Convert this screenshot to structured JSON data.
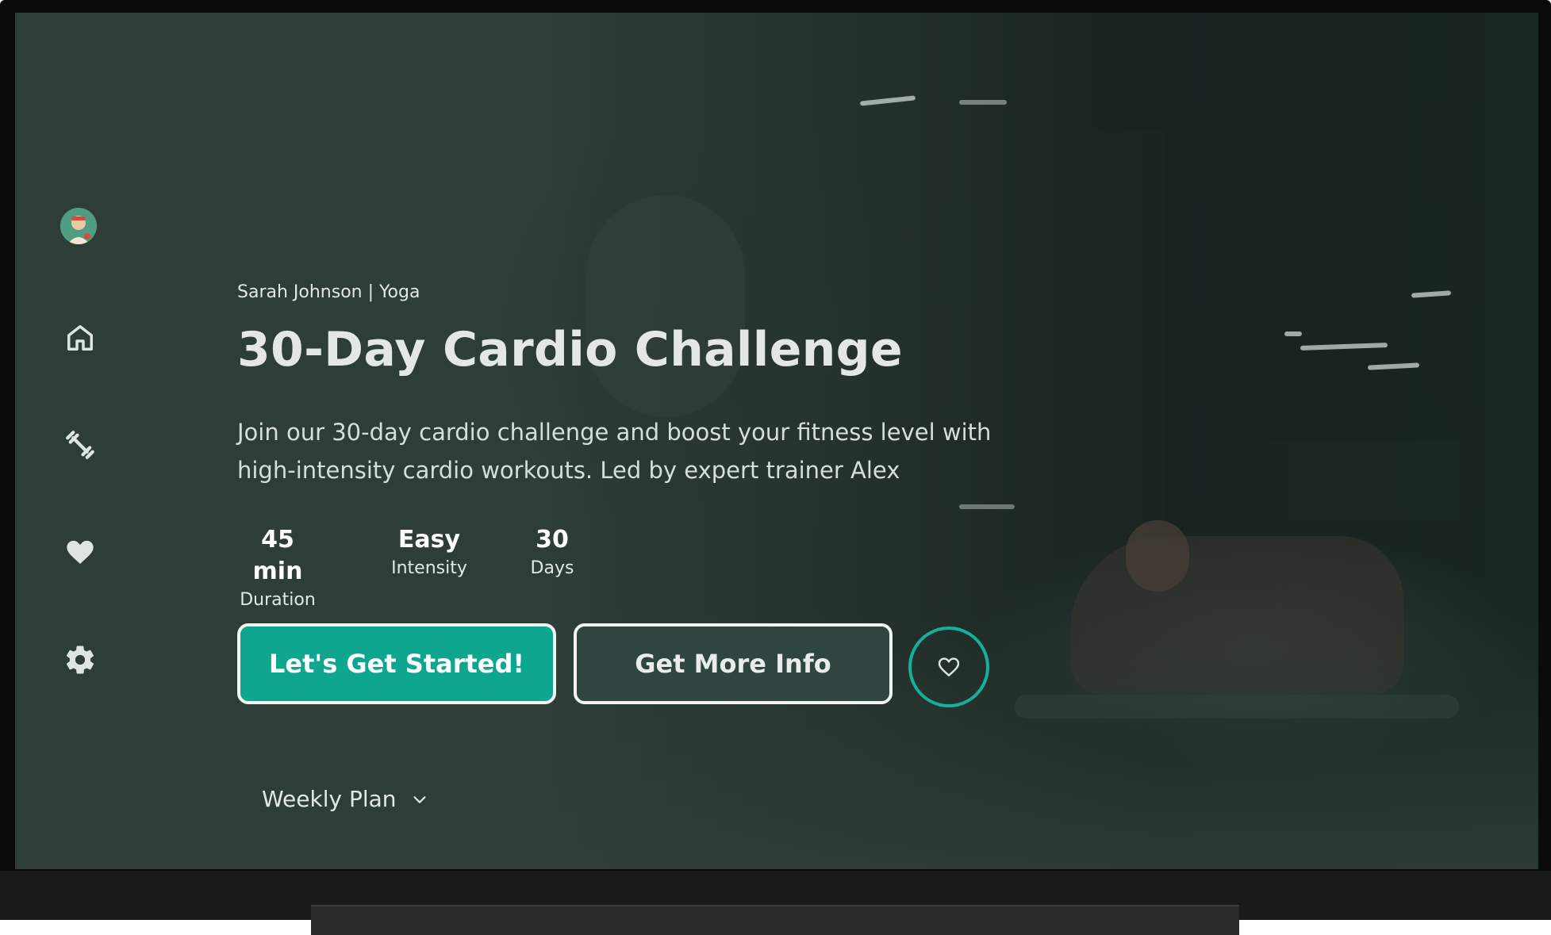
{
  "nav": {
    "items": [
      {
        "name": "avatar"
      },
      {
        "name": "home-icon"
      },
      {
        "name": "workouts-icon"
      },
      {
        "name": "favorites-icon"
      },
      {
        "name": "settings-icon"
      }
    ]
  },
  "hero": {
    "meta": "Sarah Johnson | Yoga",
    "title": "30-Day Cardio Challenge",
    "description": "Join our 30-day cardio challenge and boost your fitness level with high-intensity cardio workouts. Led by expert trainer Alex",
    "stats": [
      {
        "value": "45 min",
        "label": "Duration"
      },
      {
        "value": "Easy",
        "label": "Intensity"
      },
      {
        "value": "30",
        "label": "Days"
      }
    ],
    "primary_button": "Let's Get Started!",
    "secondary_button": "Get More Info",
    "weekly_plan": "Weekly Plan"
  },
  "colors": {
    "accent": "#0fa68f",
    "background": "#2c3b36",
    "text": "#e3e7e5"
  }
}
